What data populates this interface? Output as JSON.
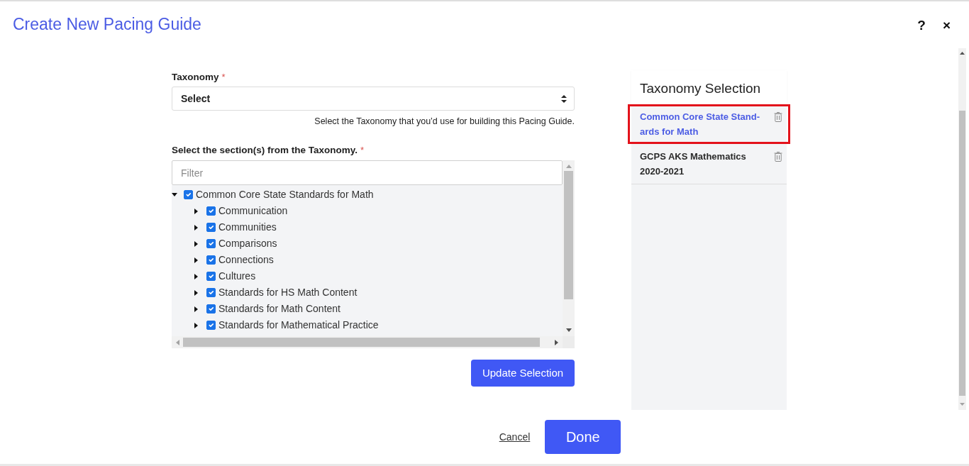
{
  "dialog": {
    "title": "Create New Pacing Guide",
    "help_button": "?",
    "close_button": "×"
  },
  "taxonomy": {
    "label": "Taxonomy",
    "required_mark": "*",
    "value": "Select",
    "help_text": "Select the Taxonomy that you’d use for building this Pacing Guide."
  },
  "sections": {
    "label": "Select the section(s) from the Taxonomy.",
    "required_mark": "*",
    "filter": {
      "placeholder": "Filter"
    },
    "tree": [
      {
        "label": "Common Core State Standards for Math",
        "checked": true,
        "expanded": true,
        "children": [
          {
            "label": "Communication",
            "checked": true,
            "expanded": false
          },
          {
            "label": "Communities",
            "checked": true,
            "expanded": false
          },
          {
            "label": "Comparisons",
            "checked": true,
            "expanded": false
          },
          {
            "label": "Connections",
            "checked": true,
            "expanded": false
          },
          {
            "label": "Cultures",
            "checked": true,
            "expanded": false
          },
          {
            "label": "Standards for HS Math Content",
            "checked": true,
            "expanded": false
          },
          {
            "label": "Standards for Math Content",
            "checked": true,
            "expanded": false
          },
          {
            "label": "Standards for Mathematical Practice",
            "checked": true,
            "expanded": false
          }
        ]
      }
    ]
  },
  "update_button": "Update Selection",
  "taxonomy_selection": {
    "title": "Taxonomy Selection",
    "items": [
      {
        "label": "Common Core State Stand-ards for Math",
        "selected": true
      },
      {
        "label": "GCPS AKS Mathematics 2020-2021",
        "selected": false
      }
    ]
  },
  "footer": {
    "cancel_link": "Cancel",
    "done_button": "Done"
  }
}
